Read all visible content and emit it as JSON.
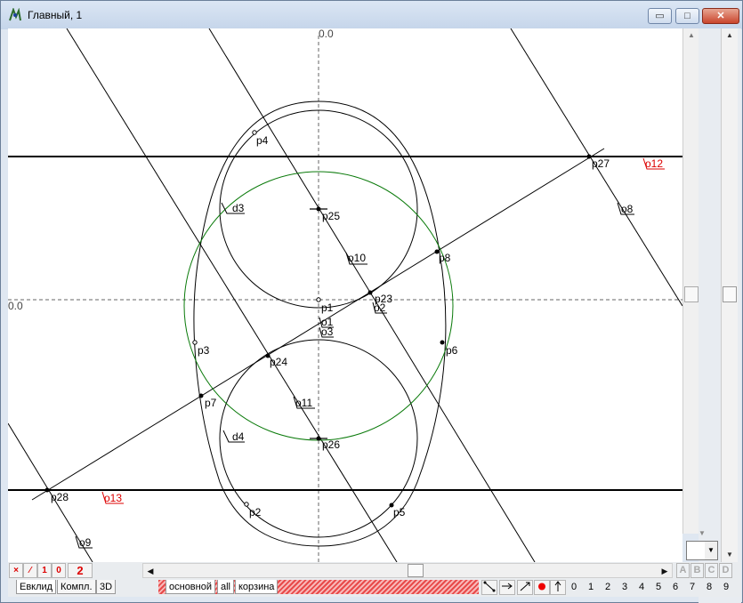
{
  "window": {
    "title": "Главный, 1",
    "controls": {
      "minimize": "▭",
      "maximize": "□",
      "close": "✕"
    }
  },
  "canvas": {
    "axis_labels": {
      "top": "0.0",
      "left": "0.0"
    },
    "point_labels": {
      "p1": "p1",
      "p2": "p2",
      "p3": "p3",
      "p4": "p4",
      "p5": "p5",
      "p6": "p6",
      "p7": "p7",
      "p8": "p8",
      "p23": "p23",
      "p24": "p24",
      "p25": "p25",
      "p26": "p26",
      "p27": "p27",
      "p28": "p28"
    },
    "object_labels": {
      "o1": "o1",
      "o2": "o2",
      "o3": "o3",
      "o8": "o8",
      "o9": "o9",
      "o10": "o10",
      "o11": "o11",
      "o12": "o12",
      "o13": "o13",
      "d3": "d3",
      "d4": "d4"
    },
    "colors": {
      "highlight_label": "#d00000",
      "green_circle": "#0a7a0a",
      "line": "#000000"
    }
  },
  "bottom_toolbar": {
    "buttons": [
      "×",
      "⁄",
      "1",
      "0",
      "2"
    ],
    "abcd": [
      "A",
      "B",
      "C",
      "D"
    ]
  },
  "tabs": {
    "view_tabs": [
      "Евклид",
      "Компл.",
      "3D"
    ],
    "layer_tabs": [
      "основной",
      "all",
      "корзина"
    ]
  },
  "tools": {
    "icons": [
      "segment-tool-icon",
      "arrow-right-icon",
      "diagonal-icon",
      "red-dot-icon",
      "arrow-up-icon"
    ],
    "numbers": [
      "0",
      "1",
      "2",
      "3",
      "4",
      "5",
      "6",
      "7",
      "8",
      "9"
    ]
  }
}
